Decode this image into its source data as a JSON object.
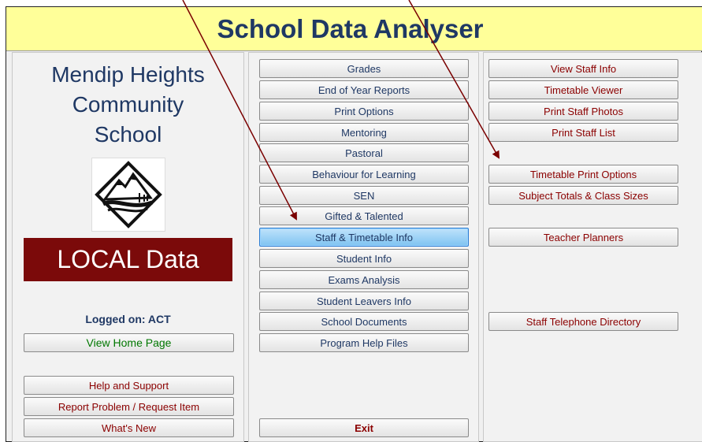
{
  "title": "School Data Analyser",
  "school_name": [
    "Mendip Heights",
    "Community",
    "School"
  ],
  "local_data": "LOCAL Data",
  "logged_on": "Logged on: ACT",
  "left": {
    "view_home": "View Home Page",
    "help": "Help and Support",
    "report": "Report Problem / Request Item",
    "whats_new": "What's New"
  },
  "menu": [
    "Grades",
    "End of Year Reports",
    "Print Options",
    "Mentoring",
    "Pastoral",
    "Behaviour for Learning",
    "SEN",
    "Gifted & Talented",
    "Staff & Timetable Info",
    "Student Info",
    "Exams Analysis",
    "Student Leavers Info",
    "School Documents",
    "Program Help Files"
  ],
  "selected_menu": "Staff & Timetable Info",
  "exit": "Exit",
  "right": {
    "view_staff_info": "View Staff Info",
    "timetable_viewer": "Timetable Viewer",
    "print_staff_photos": "Print Staff Photos",
    "print_staff_list": "Print Staff List",
    "timetable_print_options": "Timetable Print Options",
    "subject_totals": "Subject Totals & Class Sizes",
    "teacher_planners": "Teacher Planners",
    "staff_telephone": "Staff Telephone Directory"
  },
  "colors": {
    "title_bg": "#ffff99",
    "title_text": "#1f3864",
    "button_text": "#8b0000",
    "local_bg": "#7b0a0a",
    "selected": "#7fc3f1",
    "arrow": "#7a0000"
  }
}
